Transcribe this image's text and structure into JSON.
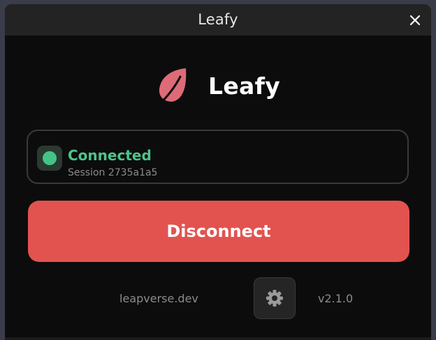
{
  "window": {
    "title": "Leafy"
  },
  "brand": {
    "name": "Leafy",
    "logo_icon": "leaf-icon",
    "logo_color": "#dd6b78"
  },
  "status": {
    "label": "Connected",
    "session": "Session 2735a1a5",
    "color": "#43c485"
  },
  "actions": {
    "disconnect_label": "Disconnect",
    "disconnect_color": "#e2534f"
  },
  "footer": {
    "link": "leapverse.dev",
    "settings_icon": "gear-icon",
    "version": "v2.1.0"
  }
}
